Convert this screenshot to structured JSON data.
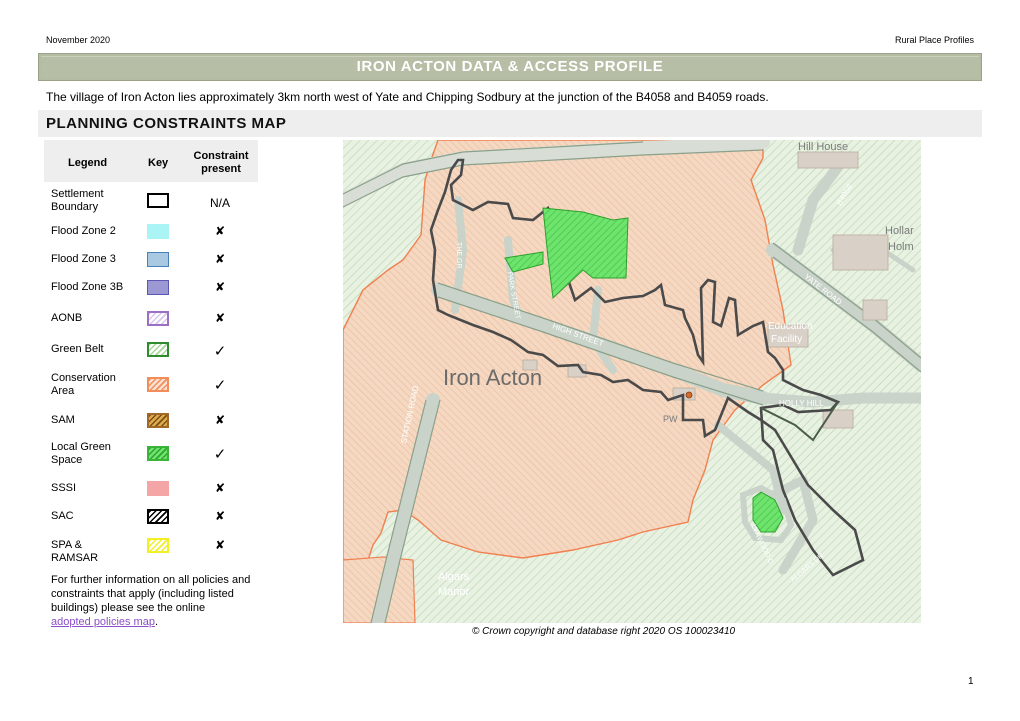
{
  "header": {
    "date": "November 2020",
    "series": "Rural Place Profiles",
    "title": "IRON ACTON DATA & ACCESS PROFILE"
  },
  "intro": "The village of Iron Acton lies approximately 3km north west of Yate and Chipping Sodbury at the junction of the B4058 and B4059 roads.",
  "section_title": "PLANNING CONSTRAINTS MAP",
  "legend": {
    "headers": {
      "legend": "Legend",
      "key": "Key",
      "present": "Constraint present"
    },
    "rows": [
      {
        "label": "Settlement Boundary",
        "present": "N/A",
        "key_style": "settlement",
        "color": "#000000"
      },
      {
        "label": "Flood Zone 2",
        "present": "✘",
        "key_style": "solid",
        "color": "#aaf4f6"
      },
      {
        "label": "Flood Zone 3",
        "present": "✘",
        "key_style": "solid",
        "color": "#a9c8e2"
      },
      {
        "label": "Flood Zone 3B",
        "present": "✘",
        "key_style": "solid",
        "color": "#9b98d4"
      },
      {
        "label": "AONB",
        "present": "✘",
        "key_style": "hatch",
        "color": "#9b6fc4"
      },
      {
        "label": "Green Belt",
        "present": "✓",
        "key_style": "hatch",
        "color": "#2e8b2e"
      },
      {
        "label": "Conservation Area",
        "present": "✓",
        "key_style": "hatch",
        "color": "#f28e5c"
      },
      {
        "label": "SAM",
        "present": "✘",
        "key_style": "hatch",
        "color": "#a0692a"
      },
      {
        "label": "Local Green Space",
        "present": "✓",
        "key_style": "hatch",
        "color": "#39b439"
      },
      {
        "label": "SSSI",
        "present": "✘",
        "key_style": "solid",
        "color": "#f4a6a6"
      },
      {
        "label": "SAC",
        "present": "✘",
        "key_style": "hatch",
        "color": "#000000"
      },
      {
        "label": "SPA & RAMSAR",
        "present": "✘",
        "key_style": "hatch",
        "color": "#f2ef27"
      }
    ]
  },
  "footnote": {
    "text": "For further information on all policies and constraints that apply (including listed buildings) please see the online",
    "link": "adopted policies map",
    "after": "."
  },
  "map": {
    "place_label": "Iron Acton",
    "labels": {
      "hill_house": "Hill House",
      "b4058": "B4058",
      "holla1": "Hollar",
      "holla2": "Holm",
      "yate_road": "YATE ROAD",
      "education1": "Education",
      "education2": "Facility",
      "high_street": "HIGH STREET",
      "holly_hill": "HOLLY HILL",
      "the_green": "THE GR",
      "park_street": "PARK STREET",
      "pw": "PW",
      "lynwood": "LYNWOOD C",
      "algars_dr": "ALGARS DR",
      "algars1": "Algars",
      "algars2": "Manor",
      "station_road": "STATION ROAD"
    }
  },
  "copyright": "© Crown copyright and database right 2020 OS 100023410",
  "page_number": "1"
}
